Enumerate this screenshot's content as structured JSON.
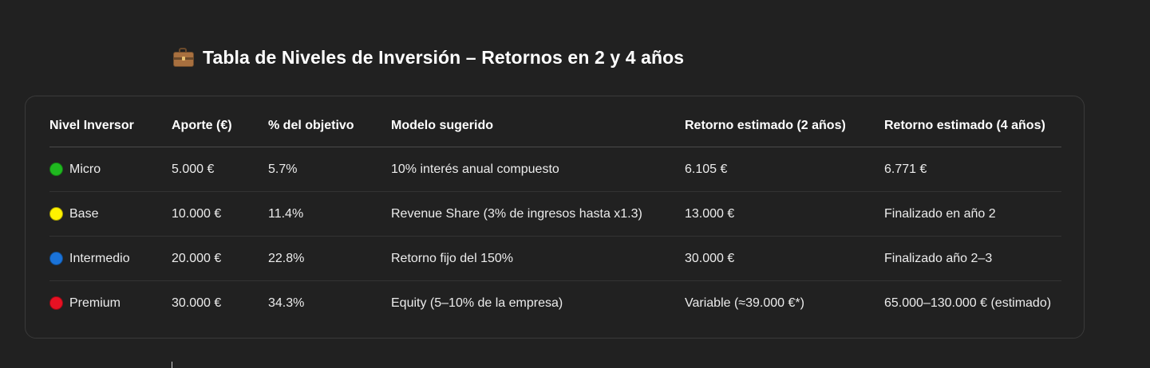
{
  "heading": {
    "icon": "briefcase-icon",
    "title": "Tabla de Niveles de Inversión – Retornos en 2 y 4 años"
  },
  "table": {
    "headers": [
      "Nivel Inversor",
      "Aporte (€)",
      "% del objetivo",
      "Modelo sugerido",
      "Retorno estimado (2 años)",
      "Retorno estimado (4 años)"
    ],
    "rows": [
      {
        "dot_color": "#1fb81f",
        "level": "Micro",
        "aporte": "5.000 €",
        "percent": "5.7%",
        "modelo": "10% interés anual compuesto",
        "retorno2": "6.105 €",
        "retorno4": "6.771 €"
      },
      {
        "dot_color": "#fff200",
        "level": "Base",
        "aporte": "10.000 €",
        "percent": "11.4%",
        "modelo": "Revenue Share (3% de ingresos hasta x1.3)",
        "retorno2": "13.000 €",
        "retorno4": "Finalizado en año 2"
      },
      {
        "dot_color": "#1a73d9",
        "level": "Intermedio",
        "aporte": "20.000 €",
        "percent": "22.8%",
        "modelo": "Retorno fijo del 150%",
        "retorno2": "30.000 €",
        "retorno4": "Finalizado año 2–3"
      },
      {
        "dot_color": "#e81123",
        "level": "Premium",
        "aporte": "30.000 €",
        "percent": "34.3%",
        "modelo": "Equity (5–10% de la empresa)",
        "retorno2": "Variable (≈39.000 €*)",
        "retorno4": "65.000–130.000 € (estimado)"
      }
    ]
  }
}
